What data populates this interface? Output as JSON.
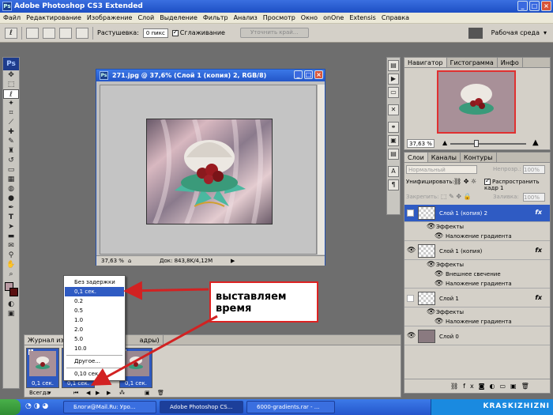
{
  "app": {
    "title": "Adobe Photoshop CS3 Extended",
    "icon_letters": "Ps"
  },
  "menu": [
    "Файл",
    "Редактирование",
    "Изображение",
    "Слой",
    "Выделение",
    "Фильтр",
    "Анализ",
    "Просмотр",
    "Окно",
    "onOne",
    "Extensis",
    "Справка"
  ],
  "options_bar": {
    "feather_label": "Растушевка:",
    "feather_value": "0 пикс",
    "antialias_label": "Сглаживание",
    "refine_edge_label": "Уточнить край...",
    "workspace_label": "Рабочая среда"
  },
  "document": {
    "title": "271.jpg @ 37,6% (Слой 1 (копия) 2, RGB/8)",
    "zoom": "37,63 %",
    "doc_info": "Док: 843,8K/4,12M"
  },
  "navigator": {
    "tabs": [
      "Навигатор",
      "Гистограмма",
      "Инфо"
    ],
    "zoom": "37,63 %"
  },
  "layers": {
    "tabs": [
      "Слои",
      "Каналы",
      "Контуры"
    ],
    "blend_mode": "Нормальный",
    "opacity_label": "Непрозр.:",
    "opacity_value": "100%",
    "unify_label": "Унифицировать:",
    "propagate_label": "Распространить кадр 1",
    "lock_label": "Закрепить:",
    "fill_label": "Заливка:",
    "fill_value": "100%",
    "fx_symbol": "fx",
    "effects_label": "Эффекты",
    "rows": [
      {
        "name": "Слой 1 (копия) 2",
        "effects": [
          "Наложение градиента"
        ]
      },
      {
        "name": "Слой 1 (копия)",
        "effects": [
          "Внешнее свечение",
          "Наложение градиента"
        ]
      },
      {
        "name": "Слой 1",
        "effects": [
          "Наложение градиента"
        ]
      },
      {
        "name": "Слой 0",
        "effects": []
      }
    ]
  },
  "animation": {
    "tab_label": "Журнал изме",
    "tab_label_end": "адры)",
    "loop_value": "Всегда",
    "frames": [
      {
        "number": "1",
        "delay": "0,1 сек."
      },
      {
        "number": "2",
        "delay": "0,1 сек."
      },
      {
        "number": "3",
        "delay": "0,1 сек."
      }
    ]
  },
  "delay_menu": {
    "items": [
      "Без задержки",
      "0,1 сек.",
      "0.2",
      "0.5",
      "1.0",
      "2.0",
      "5.0",
      "10.0",
      "Другое...",
      "0,10 сек."
    ],
    "selected_index": 1
  },
  "callout": {
    "text": "выставляем время",
    "border_color": "#d22222"
  },
  "taskbar": {
    "items": [
      "Блоги@Mail.Ru: Уро...",
      "Adobe Photoshop CS...",
      "6000-gradients.rar - ..."
    ],
    "brand": "KRASKIZHIZNI"
  }
}
